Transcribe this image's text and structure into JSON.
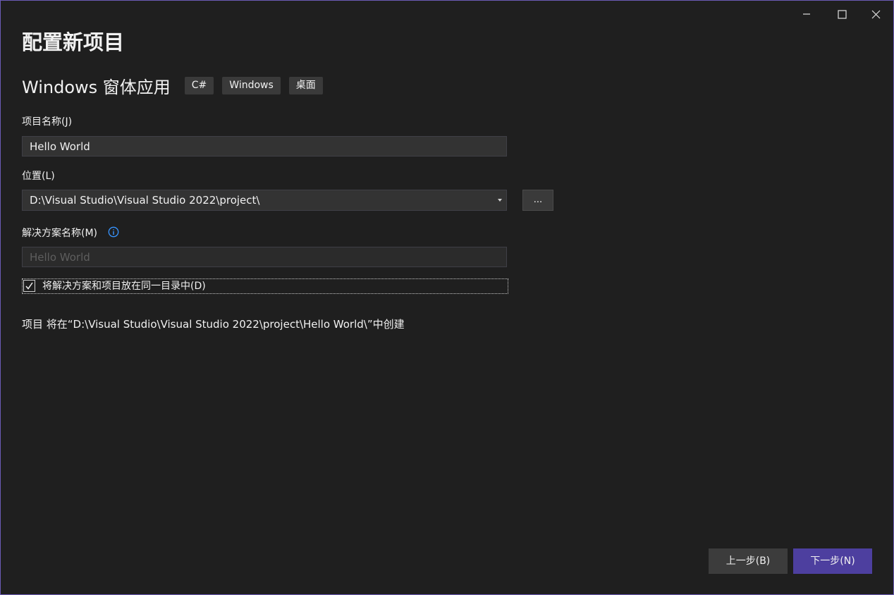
{
  "window": {
    "controls": {
      "minimize_icon": "minimize-icon",
      "maximize_icon": "maximize-icon",
      "close_icon": "close-icon"
    }
  },
  "page": {
    "title": "配置新项目"
  },
  "template": {
    "name": "Windows 窗体应用",
    "tags": [
      "C#",
      "Windows",
      "桌面"
    ]
  },
  "form": {
    "project_name": {
      "label": "项目名称(J)",
      "value": "Hello World"
    },
    "location": {
      "label": "位置(L)",
      "value": "D:\\Visual Studio\\Visual Studio 2022\\project\\",
      "browse_label": "..."
    },
    "solution_name": {
      "label": "解决方案名称(M)",
      "value": "Hello World",
      "info_icon": "info-icon"
    },
    "same_directory": {
      "label": "将解决方案和项目放在同一目录中(D)",
      "checked": true
    }
  },
  "summary": "项目 将在“D:\\Visual Studio\\Visual Studio 2022\\project\\Hello World\\”中创建",
  "footer": {
    "back_label": "上一步(B)",
    "next_label": "下一步(N)"
  },
  "colors": {
    "background": "#1f1f1f",
    "accent": "#4d3f9f",
    "window_border": "#6b5bb5",
    "info": "#3794ff"
  }
}
